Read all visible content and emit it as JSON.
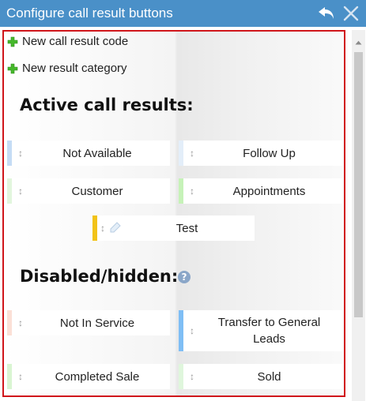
{
  "window": {
    "title": "Configure call result buttons"
  },
  "actions": {
    "new_code": "New call result code",
    "new_category": "New result category"
  },
  "sections": {
    "active_heading": "Active call results:",
    "disabled_heading": "Disabled/hidden:",
    "help_glyph": "?"
  },
  "active_results": [
    {
      "label": "Not Available",
      "color": "#c5dcf5"
    },
    {
      "label": "Follow Up",
      "color": "#e3eef9"
    },
    {
      "label": "Customer",
      "color": "#e2f6dd"
    },
    {
      "label": "Appointments",
      "color": "#c6f2b8"
    },
    {
      "label": "Test",
      "color": "#f2c318"
    }
  ],
  "disabled_results": [
    {
      "label": "Not In Service",
      "color": "#fbe0d6"
    },
    {
      "label": "Transfer to General Leads",
      "color": "#7fbef5"
    },
    {
      "label": "Completed Sale",
      "color": "#d9f5d2"
    },
    {
      "label": "Sold",
      "color": "#dff6dc"
    }
  ],
  "icons": {
    "back": "undo-arrow-icon",
    "close": "close-icon",
    "add": "plus-icon",
    "drag": "drag-handle-icon",
    "help": "help-icon",
    "edit": "edit-icon"
  }
}
